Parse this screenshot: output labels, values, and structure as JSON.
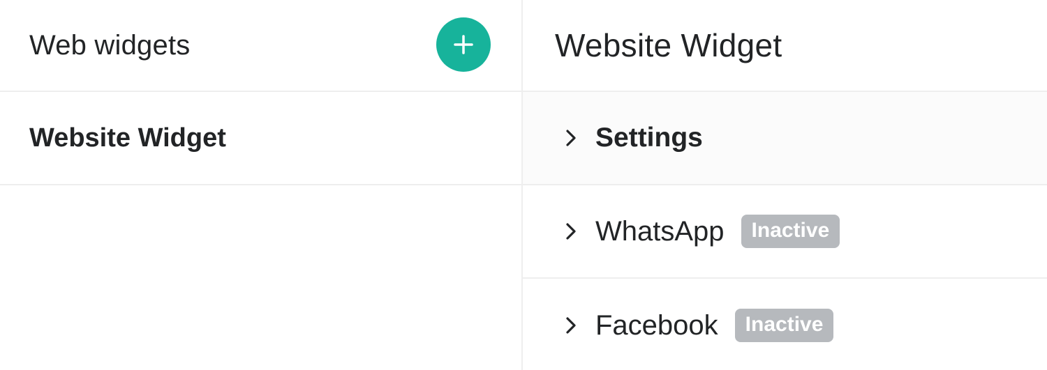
{
  "left": {
    "title": "Web widgets",
    "add_button_icon": "plus-icon",
    "items": [
      {
        "label": "Website Widget"
      }
    ]
  },
  "right": {
    "title": "Website Widget",
    "sections": [
      {
        "label": "Settings",
        "icon": "chevron-right-icon"
      },
      {
        "label": "WhatsApp",
        "badge": "Inactive",
        "icon": "chevron-right-icon"
      },
      {
        "label": "Facebook",
        "badge": "Inactive",
        "icon": "chevron-right-icon"
      }
    ]
  },
  "colors": {
    "accent": "#17b39b",
    "badge_bg": "#b6b9bd",
    "divider": "#eeeeee"
  }
}
